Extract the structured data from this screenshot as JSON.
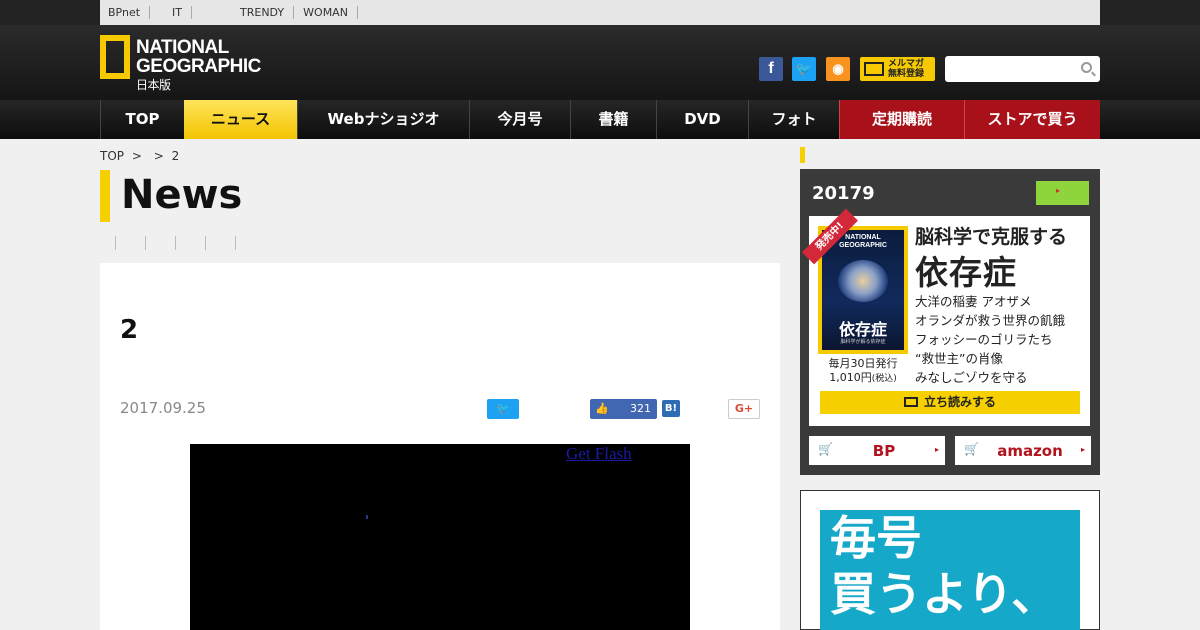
{
  "utilbar": {
    "links": [
      "BPnet",
      "",
      "IT",
      "",
      "",
      "",
      "TRENDY",
      "WOMAN",
      "",
      "",
      ""
    ]
  },
  "header": {
    "logo": {
      "line1": "NATIONAL",
      "line2": "GEOGRAPHIC",
      "line3": "日本版"
    },
    "social": {
      "facebook": "f",
      "twitter": "t",
      "rss": "rss"
    },
    "mailmag": {
      "line1": "メルマガ",
      "line2": "無料登録"
    },
    "search": {
      "placeholder": ""
    }
  },
  "nav": {
    "items": [
      "TOP",
      "ニュース",
      "Webナショジオ",
      "今月号",
      "書籍",
      "DVD",
      "フォト",
      "定期購読",
      "ストアで買う"
    ]
  },
  "breadcrumb": {
    "items": [
      "TOP",
      "",
      "2"
    ]
  },
  "page": {
    "title": "News"
  },
  "article": {
    "title": "2",
    "date": "2017.09.25",
    "share": {
      "like_count": "321",
      "hatena": "B!",
      "gplus": "G+"
    },
    "flash_link": "Get Flash"
  },
  "sidebar": {
    "magazine": {
      "heading": "20179",
      "ribbon": "発売中!",
      "cover": {
        "brand1": "NATIONAL",
        "brand2": "GEOGRAPHIC",
        "title": "依存症",
        "subtitle": "脳科学が解る依存症"
      },
      "issue_line1": "毎月30日発行",
      "issue_line2": "1,010円",
      "issue_tax": "(税込)",
      "feature_lead": "脳科学で克服する",
      "feature_main": "依存症",
      "features": [
        "大洋の稲妻 アオザメ",
        "オランダが救う世界の飢餓",
        "フォッシーのゴリラたち",
        "“救世主”の肖像",
        "みなしごゾウを守る"
      ],
      "tachiyomi": "立ち読みする",
      "buy_bp": "BP",
      "buy_amazon": "amazon"
    },
    "ad": {
      "line1": "毎号",
      "line2": "買うより、"
    }
  },
  "colors": {
    "accent_yellow": "#f6d000",
    "store_red": "#a8101a",
    "dark": "#1a1a1a"
  }
}
